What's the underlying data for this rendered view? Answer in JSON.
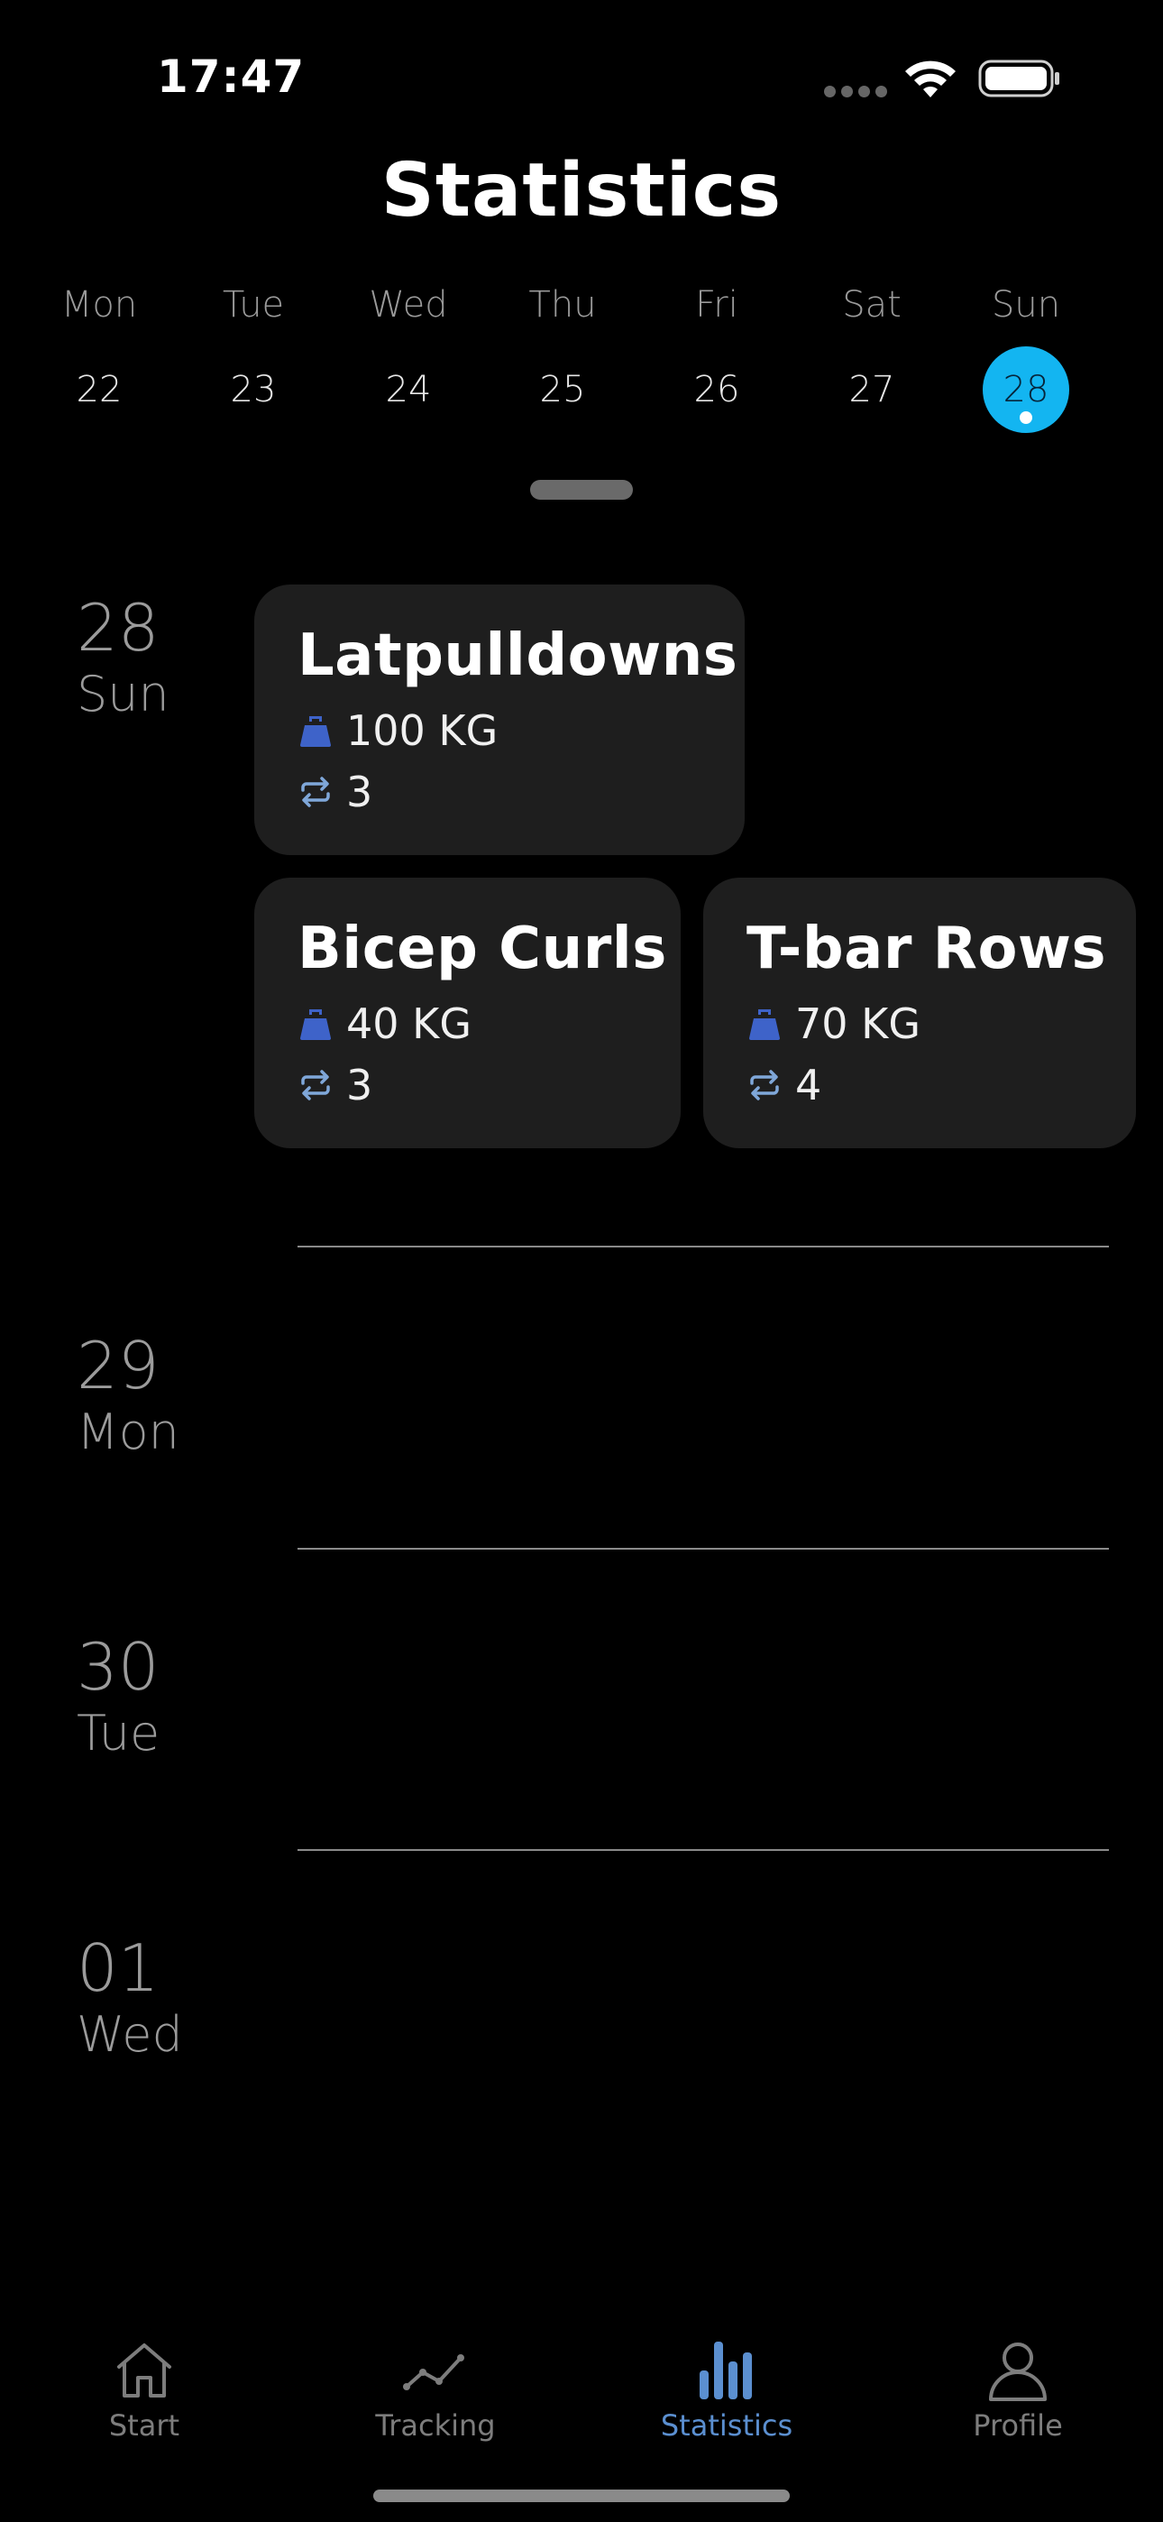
{
  "status_bar": {
    "time": "17:47"
  },
  "header": {
    "title": "Statistics"
  },
  "week": [
    {
      "name": "Mon",
      "num": "22"
    },
    {
      "name": "Tue",
      "num": "23"
    },
    {
      "name": "Wed",
      "num": "24"
    },
    {
      "name": "Thu",
      "num": "25"
    },
    {
      "name": "Fri",
      "num": "26"
    },
    {
      "name": "Sat",
      "num": "27"
    },
    {
      "name": "Sun",
      "num": "28",
      "selected": true
    }
  ],
  "days": [
    {
      "num": "28",
      "weekday": "Sun"
    },
    {
      "num": "29",
      "weekday": "Mon"
    },
    {
      "num": "30",
      "weekday": "Tue"
    },
    {
      "num": "01",
      "weekday": "Wed"
    }
  ],
  "exercises": [
    {
      "name": "Latpulldowns",
      "weight": "100 KG",
      "sets": "3"
    },
    {
      "name": "Bicep Curls",
      "weight": "40 KG",
      "sets": "3"
    },
    {
      "name": "T-bar Rows",
      "weight": "70 KG",
      "sets": "4"
    }
  ],
  "tabs": [
    {
      "label": "Start",
      "icon": "house-icon"
    },
    {
      "label": "Tracking",
      "icon": "trend-line-icon"
    },
    {
      "label": "Statistics",
      "icon": "bar-chart-icon",
      "active": true
    },
    {
      "label": "Profile",
      "icon": "person-icon"
    }
  ],
  "colors": {
    "accent": "#13b5f1",
    "tab_active": "#5b8fd0",
    "weight_icon": "#3e63c9",
    "repeat_icon": "#7fa7d9",
    "card_bg": "#1e1e1e"
  }
}
